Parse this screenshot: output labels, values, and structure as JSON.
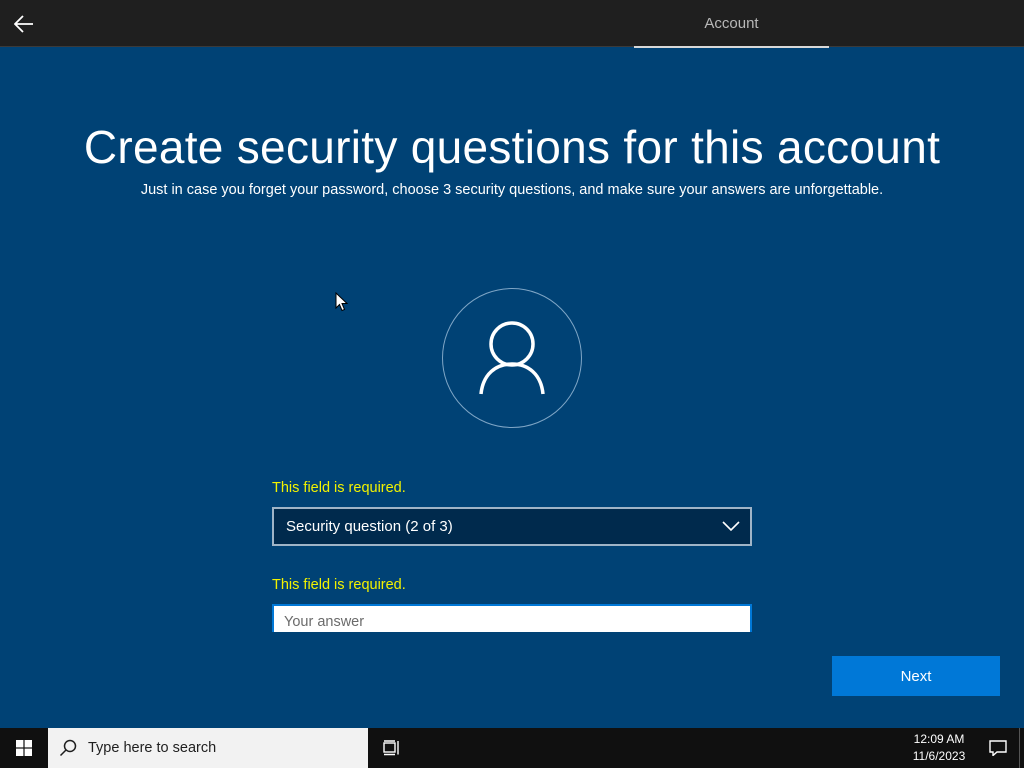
{
  "header": {
    "tab_label": "Account",
    "back_icon": "back-arrow-icon"
  },
  "main": {
    "title": "Create security questions for this account",
    "subtitle": "Just in case you forget your password, choose 3 security questions, and make sure your answers are unforgettable.",
    "avatar_icon": "user-icon",
    "question_error": "This field is required.",
    "question_select_value": "Security question (2 of 3)",
    "answer_error": "This field is required.",
    "answer_placeholder": "Your answer",
    "answer_value": "",
    "next_label": "Next"
  },
  "taskbar": {
    "search_placeholder": "Type here to search",
    "time": "12:09 AM",
    "date": "11/6/2023"
  },
  "colors": {
    "background": "#004275",
    "accent": "#0078d7",
    "error": "#f2f200",
    "topbar": "#1f1f1f",
    "taskbar": "#101010"
  }
}
